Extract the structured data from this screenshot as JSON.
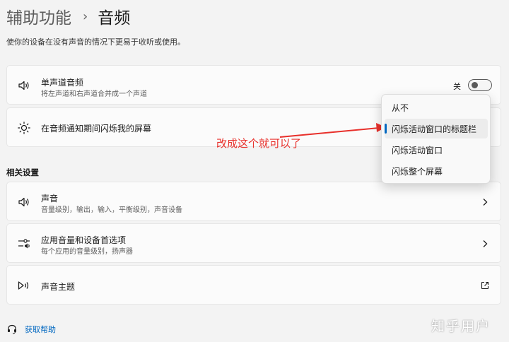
{
  "breadcrumb": {
    "parent": "辅助功能",
    "separator": "›",
    "current": "音频"
  },
  "subtitle": "使你的设备在没有声音的情况下更易于收听或使用。",
  "mono_audio": {
    "title": "单声道音频",
    "description": "将左声道和右声道合并成一个声道",
    "toggle_label": "关",
    "toggle_state": "off",
    "icon": "speaker-icon"
  },
  "flash_screen": {
    "title": "在音频通知期间闪烁我的屏幕",
    "icon": "brightness-icon",
    "options": [
      "从不",
      "闪烁活动窗口的标题栏",
      "闪烁活动窗口",
      "闪烁整个屏幕"
    ],
    "selected_index": 1
  },
  "annotation": {
    "text": "改成这个就可以了",
    "color": "#e8302b"
  },
  "related_settings": {
    "header": "相关设置",
    "items": [
      {
        "title": "声音",
        "description": "音量级别，输出，输入，平衡级别，声音设备",
        "icon": "speaker-icon",
        "action_icon": "chevron-right-icon"
      },
      {
        "title": "应用音量和设备首选项",
        "description": "每个应用的音量级别，扬声器",
        "icon": "mixer-icon",
        "action_icon": "chevron-right-icon"
      },
      {
        "title": "声音主题",
        "description": "",
        "icon": "sound-theme-icon",
        "action_icon": "external-link-icon"
      }
    ]
  },
  "help": {
    "label": "获取帮助",
    "icon": "help-icon"
  },
  "watermark": "知乎用户",
  "colors": {
    "accent": "#0067c0",
    "annotation": "#e8302b",
    "background": "#f3f3f3",
    "card": "#fbfbfb"
  }
}
